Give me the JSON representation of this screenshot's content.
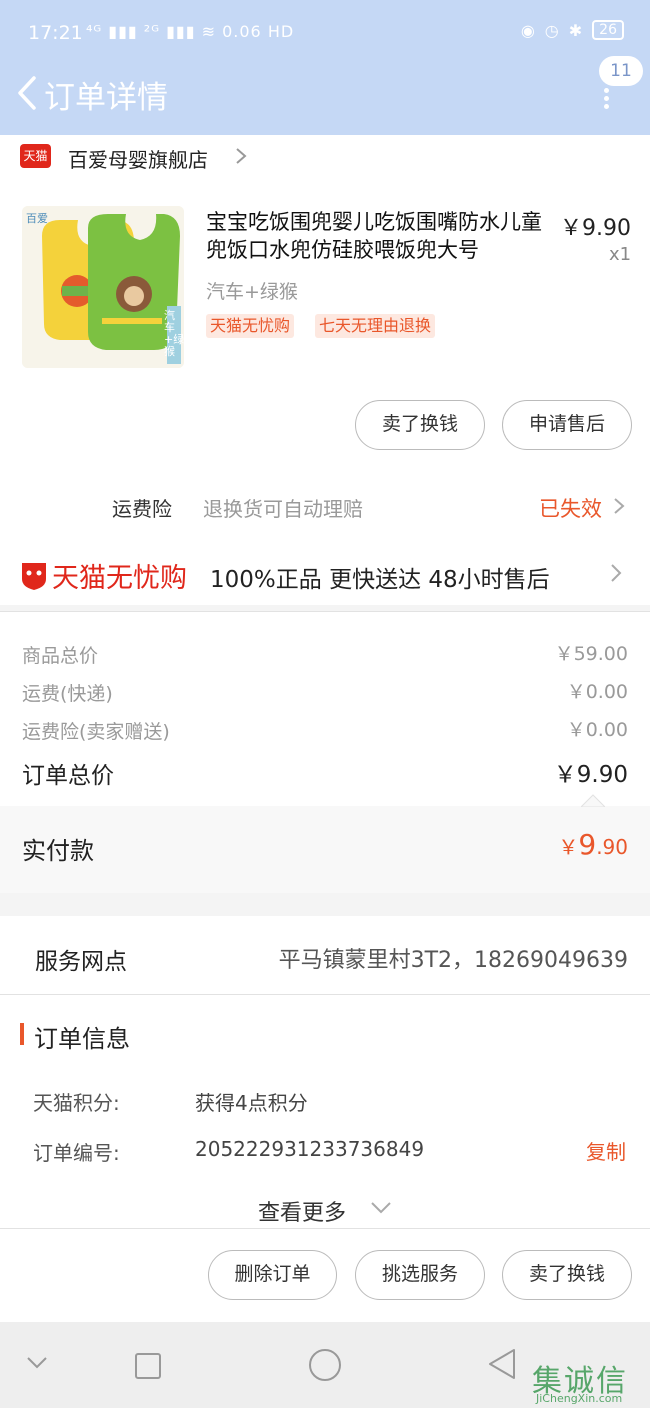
{
  "status_bar": {
    "time": "17:21",
    "network": "⁴ᴳ ▮▮▮ ²ᴳ ▮▮▮ ≋ 0.06 HD",
    "battery": "26"
  },
  "header": {
    "title": "订单详情",
    "badge_count": "11"
  },
  "shop": {
    "logo_text": "天猫",
    "name": "百爱母婴旗舰店"
  },
  "product": {
    "title": "宝宝吃饭围兜婴儿吃饭围嘴防水儿童兜饭口水兜仿硅胶喂饭兜大号",
    "price": "￥9.90",
    "quantity": "x1",
    "spec": "汽车+绿猴",
    "tags": [
      "天猫无忧购",
      "七天无理由退换"
    ],
    "thumb_brand": "百爱",
    "thumb_caption": "汽车+绿猴"
  },
  "product_actions": {
    "sell_label": "卖了换钱",
    "after_sale_label": "申请售后"
  },
  "freight_insurance": {
    "label": "运费险",
    "desc": "退换货可自动理赔",
    "status": "已失效"
  },
  "guarantee": {
    "logo_text": "天猫无忧购",
    "text": "100%正品  更快送达  48小时售后"
  },
  "summary": {
    "rows": [
      {
        "label": "商品总价",
        "value": "￥59.00"
      },
      {
        "label": "运费(快递)",
        "value": "￥0.00"
      },
      {
        "label": "运费险(卖家赠送)",
        "value": "￥0.00"
      }
    ],
    "total_label": "订单总价",
    "total_value": "￥9.90"
  },
  "paid": {
    "label": "实付款",
    "currency": "￥",
    "int": "9",
    "dec": ".90"
  },
  "service_point": {
    "label": "服务网点",
    "value": "平马镇蒙里村3T2，18269049639"
  },
  "order_info": {
    "heading": "订单信息",
    "points_label": "天猫积分:",
    "points_value": "获得4点积分",
    "order_no_label": "订单编号:",
    "order_no_value": "205222931233736849",
    "copy_label": "复制",
    "more_label": "查看更多"
  },
  "bottom_actions": {
    "delete_label": "删除订单",
    "service_label": "挑选服务",
    "sell_label": "卖了换钱"
  },
  "watermark": {
    "text": "集诚信",
    "url": "JiChengXin.com"
  },
  "colors": {
    "accent": "#e9572b",
    "header_bg": "#c5d8f5",
    "tmall_red": "#e0271b"
  }
}
